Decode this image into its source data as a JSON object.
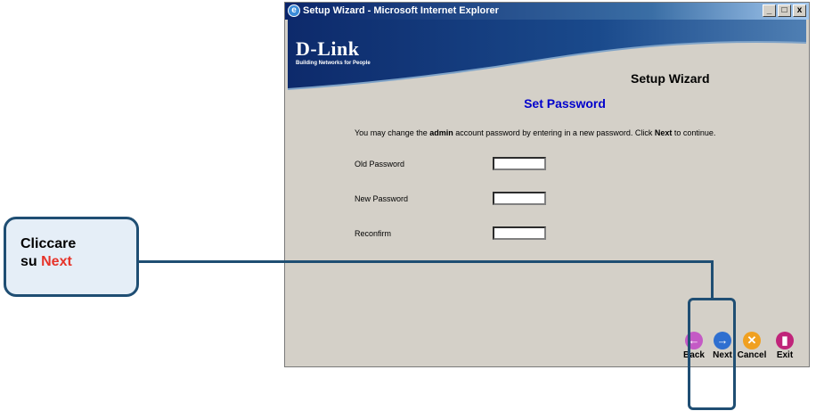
{
  "window": {
    "title": "Setup Wizard - Microsoft Internet Explorer",
    "min_label": "_",
    "max_label": "□",
    "close_label": "x"
  },
  "banner": {
    "brand": "D-Link",
    "tagline": "Building Networks for People",
    "title": "Setup Wizard"
  },
  "page": {
    "heading": "Set Password",
    "intro_pre": "You may change the ",
    "intro_admin": "admin",
    "intro_mid": " account password by entering in a new password. Click ",
    "intro_next": "Next",
    "intro_post": " to continue."
  },
  "form": {
    "old_password_label": "Old Password",
    "old_password_value": "",
    "new_password_label": "New Password",
    "new_password_value": "",
    "reconfirm_label": "Reconfirm",
    "reconfirm_value": ""
  },
  "nav": {
    "back_label": "Back",
    "back_icon": "back-arrow-icon",
    "back_color": "#c45ac5",
    "next_label": "Next",
    "next_icon": "next-arrow-icon",
    "next_color": "#2f6fd0",
    "cancel_label": "Cancel",
    "cancel_icon": "cancel-x-icon",
    "cancel_color": "#f0a020",
    "exit_label": "Exit",
    "exit_icon": "exit-door-icon",
    "exit_color": "#c0247a"
  },
  "callout": {
    "line1": "Cliccare",
    "line2_prefix": "su ",
    "line2_highlight": "Next",
    "highlight_color": "#e63329"
  }
}
